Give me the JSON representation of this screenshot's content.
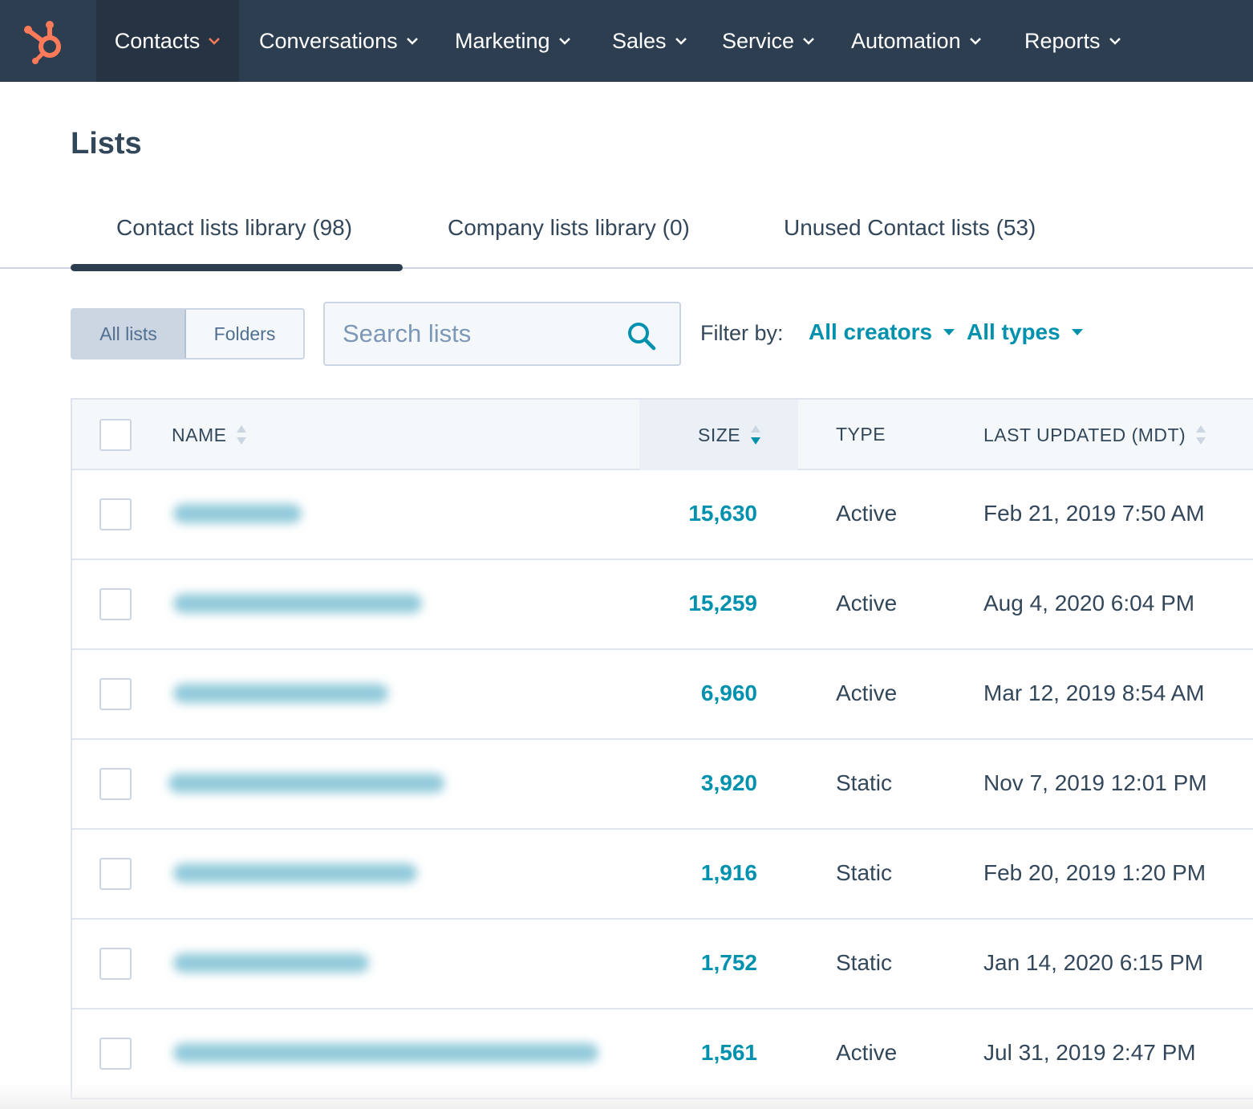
{
  "nav": {
    "items": [
      {
        "label": "Contacts"
      },
      {
        "label": "Conversations"
      },
      {
        "label": "Marketing"
      },
      {
        "label": "Sales"
      },
      {
        "label": "Service"
      },
      {
        "label": "Automation"
      },
      {
        "label": "Reports"
      }
    ],
    "active": "Contacts",
    "logo_icon": "hubspot-sprocket-icon",
    "colors": {
      "bar": "#2d3e50",
      "accent": "#ff7a59"
    }
  },
  "page": {
    "title": "Lists"
  },
  "tabs": [
    {
      "label": "Contact lists library (98)",
      "active": true
    },
    {
      "label": "Company lists library (0)",
      "active": false
    },
    {
      "label": "Unused Contact lists (53)",
      "active": false
    }
  ],
  "toolbar": {
    "view_toggle": {
      "all_lists": "All lists",
      "folders": "Folders",
      "selected": "All lists"
    },
    "search": {
      "placeholder": "Search lists"
    },
    "filter": {
      "label": "Filter by:",
      "creators": "All creators",
      "types": "All types"
    }
  },
  "table": {
    "columns": {
      "name": "NAME",
      "size": "SIZE",
      "type": "TYPE",
      "last_updated": "LAST UPDATED (MDT)"
    },
    "sorted_by": "SIZE",
    "rows": [
      {
        "size": "15,630",
        "type": "Active",
        "last_updated": "Feb 21, 2019 7:50 AM"
      },
      {
        "size": "15,259",
        "type": "Active",
        "last_updated": "Aug 4, 2020 6:04 PM"
      },
      {
        "size": "6,960",
        "type": "Active",
        "last_updated": "Mar 12, 2019 8:54 AM"
      },
      {
        "size": "3,920",
        "type": "Static",
        "last_updated": "Nov 7, 2019 12:01 PM"
      },
      {
        "size": "1,916",
        "type": "Static",
        "last_updated": "Feb 20, 2019 1:20 PM"
      },
      {
        "size": "1,752",
        "type": "Static",
        "last_updated": "Jan 14, 2020 6:15 PM"
      },
      {
        "size": "1,561",
        "type": "Active",
        "last_updated": "Jul 31, 2019 2:47 PM"
      }
    ]
  }
}
